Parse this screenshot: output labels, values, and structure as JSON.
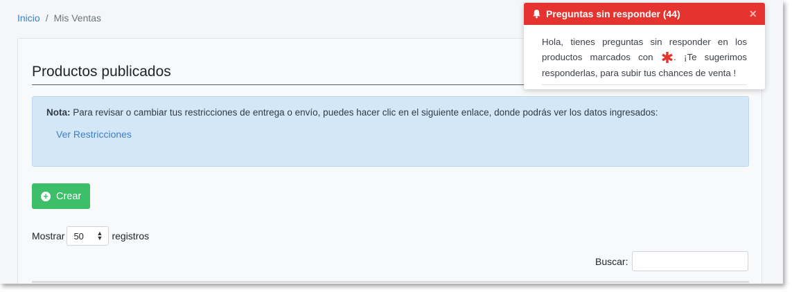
{
  "breadcrumb": {
    "home": "Inicio",
    "separator": "/",
    "current": "Mis Ventas"
  },
  "page": {
    "title": "Productos publicados"
  },
  "note": {
    "label": "Nota:",
    "text": "Para revisar o cambiar tus restricciones de entrega o envío, puedes hacer clic en el siguiente enlace, donde podrás ver los datos ingresados:",
    "link": "Ver Restricciones"
  },
  "actions": {
    "create_label": "Crear",
    "create_icon": "plus-circle-icon"
  },
  "length_menu": {
    "before": "Mostrar",
    "value": "50",
    "after": "registros"
  },
  "search": {
    "label": "Buscar:",
    "value": ""
  },
  "notification": {
    "title": "Preguntas sin responder (44)",
    "icon": "bell-icon",
    "close": "×",
    "body_before": "Hola, tienes preguntas sin responder en los productos marcados con",
    "marker": "✱",
    "body_after": ". ¡Te sugerimos responderlas, para subir tus chances de venta !"
  },
  "colors": {
    "accent_link": "#3d7ec6",
    "success": "#3dbe69",
    "danger": "#e5342f",
    "note_bg": "#d4e7f7"
  }
}
